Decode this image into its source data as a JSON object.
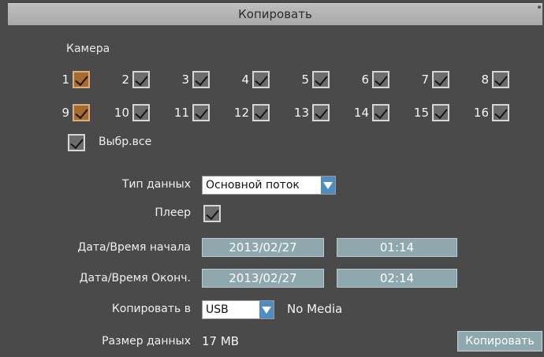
{
  "window": {
    "title": "Копировать"
  },
  "camera_section": {
    "label": "Камера",
    "cameras": [
      {
        "num": "1",
        "checked": true,
        "highlight": true
      },
      {
        "num": "2",
        "checked": true,
        "highlight": false
      },
      {
        "num": "3",
        "checked": true,
        "highlight": false
      },
      {
        "num": "4",
        "checked": true,
        "highlight": false
      },
      {
        "num": "5",
        "checked": true,
        "highlight": false
      },
      {
        "num": "6",
        "checked": true,
        "highlight": false
      },
      {
        "num": "7",
        "checked": true,
        "highlight": false
      },
      {
        "num": "8",
        "checked": true,
        "highlight": false
      },
      {
        "num": "9",
        "checked": true,
        "highlight": true
      },
      {
        "num": "10",
        "checked": true,
        "highlight": false
      },
      {
        "num": "11",
        "checked": true,
        "highlight": false
      },
      {
        "num": "12",
        "checked": true,
        "highlight": false
      },
      {
        "num": "13",
        "checked": true,
        "highlight": false
      },
      {
        "num": "14",
        "checked": true,
        "highlight": false
      },
      {
        "num": "15",
        "checked": true,
        "highlight": false
      },
      {
        "num": "16",
        "checked": true,
        "highlight": false
      }
    ],
    "select_all": {
      "label": "Выбр.все",
      "checked": true
    }
  },
  "form": {
    "data_type": {
      "label": "Тип данных",
      "value": "Основной поток"
    },
    "player": {
      "label": "Плеер",
      "checked": true
    },
    "start": {
      "label": "Дата/Время начала",
      "date": "2013/02/27",
      "time": "01:14"
    },
    "end": {
      "label": "Дата/Время Оконч.",
      "date": "2013/02/27",
      "time": "02:14"
    },
    "copy_to": {
      "label": "Копировать в",
      "value": "USB",
      "status": "No Media"
    },
    "data_size": {
      "label": "Размер данных",
      "value": "17 MB"
    }
  },
  "actions": {
    "copy_button": "Копировать"
  },
  "colors": {
    "background": "#4a4a4a",
    "field": "#8ea8ad",
    "highlight_checkbox": "#a86a2e",
    "dropdown_arrow": "#4f8cbf"
  }
}
